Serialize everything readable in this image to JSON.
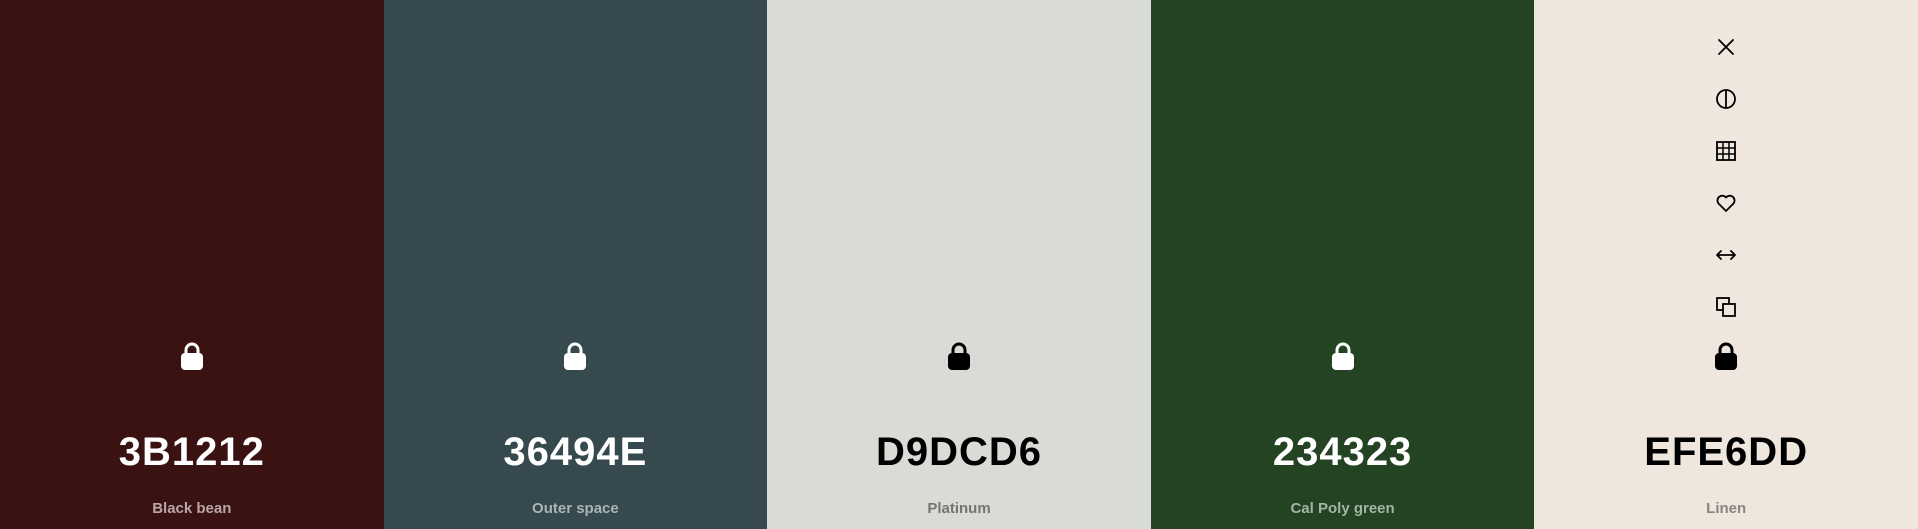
{
  "palette": {
    "swatches": [
      {
        "hex": "3B1212",
        "name": "Black bean",
        "color": "#3B1212",
        "text_color": "#FFFFFF",
        "name_color": "#B9A7A7"
      },
      {
        "hex": "36494E",
        "name": "Outer space",
        "color": "#36494E",
        "text_color": "#FFFFFF",
        "name_color": "#AAB5B8"
      },
      {
        "hex": "D9DCD6",
        "name": "Platinum",
        "color": "#D9DCD6",
        "text_color": "#000000",
        "name_color": "#737571"
      },
      {
        "hex": "234323",
        "name": "Cal Poly green",
        "color": "#234323",
        "text_color": "#FFFFFF",
        "name_color": "#A5B3A5"
      },
      {
        "hex": "EFE6DD",
        "name": "Linen",
        "color": "#EFE6DD",
        "text_color": "#000000",
        "name_color": "#8A8580"
      }
    ]
  },
  "toolbar": {
    "icons": [
      "close-icon",
      "contrast-icon",
      "grid-icon",
      "heart-icon",
      "arrows-horizontal-icon",
      "copy-icon",
      "lock-icon"
    ]
  }
}
